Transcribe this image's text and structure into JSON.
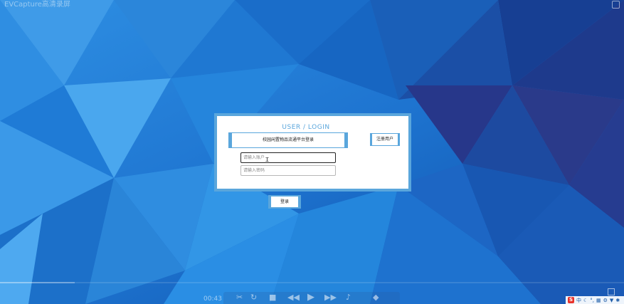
{
  "screen": {
    "watermark": "EVCapture高清录屏"
  },
  "login": {
    "title": "USER / LOGIN",
    "banner": "校园闲置物品流通平台登录",
    "register_label": "注册用户",
    "account_placeholder": "请输入账户",
    "password_placeholder": "请输入密码",
    "submit_label": "登录"
  },
  "player": {
    "time": "00:43",
    "progress": 0.12,
    "icons": [
      "crop-icon",
      "rotate-icon",
      "stop-icon",
      "rewind-icon",
      "play-icon",
      "fast-forward-icon",
      "volume-icon",
      "speed-icon"
    ]
  },
  "tray": {
    "logo": "S",
    "lang": "中",
    "items": [
      "moon-icon",
      "punct-icon",
      "keyboard-icon",
      "settings-icon",
      "shirt-icon",
      "tools-icon"
    ]
  },
  "colors": {
    "accent": "#5aa6dc",
    "bg_dark": "#0d3f8f",
    "bg_light": "#4aa3e6"
  }
}
